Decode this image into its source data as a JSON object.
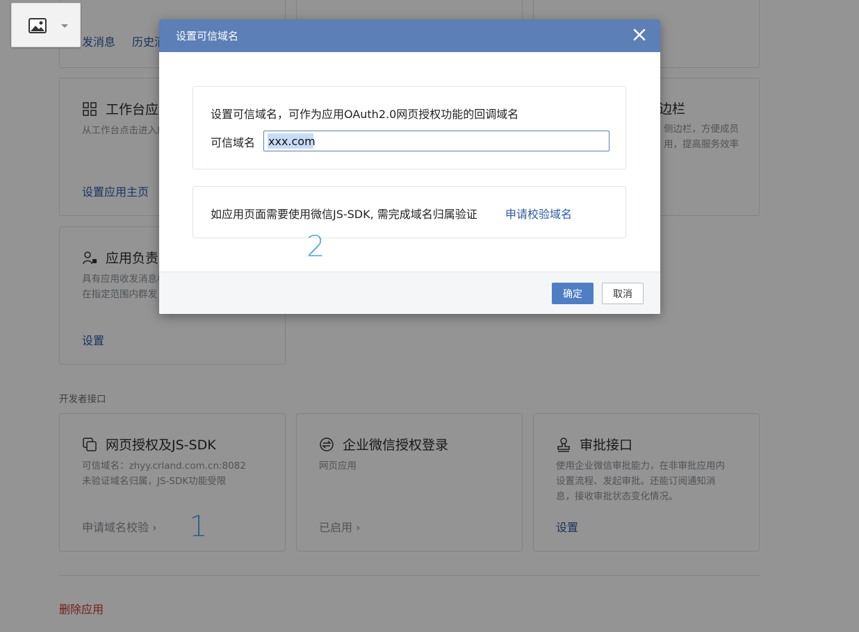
{
  "background": {
    "message_links": [
      "发消息",
      "历史消息"
    ],
    "workbench_card": {
      "title": "工作台应用主页",
      "desc": "从工作台点击进入应用的主页",
      "link": "设置应用主页"
    },
    "sidebar_card": {
      "title": "边栏",
      "desc_line1": "侧边栏，方便成员",
      "desc_line2": "用，提高服务效率"
    },
    "owner_card": {
      "title": "应用负责人",
      "desc_line1": "具有应用收发消息权限",
      "desc_line2": "在指定范围内群发",
      "link": "设置"
    },
    "section_label": "开发者接口",
    "dev_cards": [
      {
        "title": "网页授权及JS-SDK",
        "desc_line1": "可信域名：zhyy.crland.com.cn:8082",
        "desc_line2": "未验证域名归属，JS-SDK功能受限",
        "link": "申请域名校验 ›",
        "icon": "copy-icon"
      },
      {
        "title": "企业微信授权登录",
        "desc_line1": "网页应用",
        "link": "已启用 ›",
        "icon": "swap-icon"
      },
      {
        "title": "审批接口",
        "desc_line1": "使用企业微信审批能力，在非审批应用内",
        "desc_line2": "设置流程、发起审批。还能订阅通知消",
        "desc_line3": "息，接收审批状态变化情况。",
        "link": "设置",
        "icon": "stamp-icon"
      }
    ],
    "delete_label": "删除应用",
    "annotations": {
      "one": "1",
      "two": "2"
    }
  },
  "dialog": {
    "title": "设置可信域名",
    "description": "设置可信域名，可作为应用OAuth2.0网页授权功能的回调域名",
    "field_label": "可信域名",
    "field_value": "xxx.com",
    "jssdk_text": "如应用页面需要使用微信JS-SDK, 需完成域名归属验证",
    "jssdk_link": "申请校验域名",
    "ok_label": "确定",
    "cancel_label": "取消"
  },
  "colors": {
    "accent": "#5b7fb6",
    "link": "#2d5aa0",
    "danger": "#c0392b",
    "annotation": "#5aa9e6"
  }
}
